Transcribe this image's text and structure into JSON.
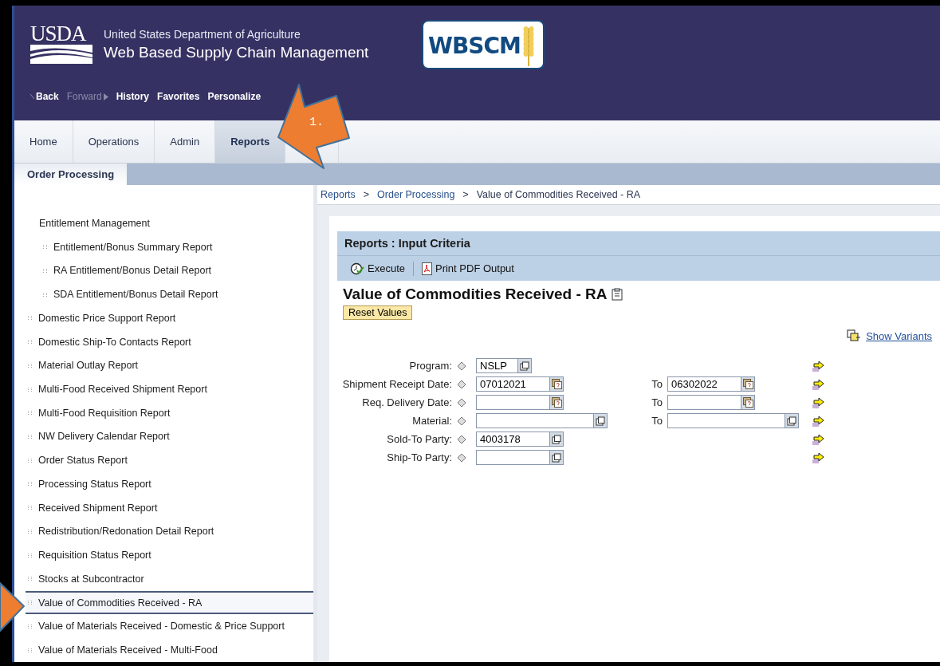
{
  "header": {
    "usda_mark": "USDA",
    "agency": "United States Department of Agriculture",
    "app_name": "Web Based Supply Chain Management",
    "logo": "WBSCM"
  },
  "nav": [
    {
      "label": "Back",
      "disabled": false,
      "kind": "back"
    },
    {
      "label": "Forward",
      "disabled": true,
      "kind": "forward"
    },
    {
      "label": "History",
      "disabled": false,
      "kind": "plain"
    },
    {
      "label": "Favorites",
      "disabled": false,
      "kind": "plain"
    },
    {
      "label": "Personalize",
      "disabled": false,
      "kind": "plain"
    }
  ],
  "tabs": [
    {
      "label": "Home",
      "selected": false
    },
    {
      "label": "Operations",
      "selected": false
    },
    {
      "label": "Admin",
      "selected": false
    },
    {
      "label": "Reports",
      "selected": true
    }
  ],
  "subtabs": [
    {
      "label": "Order Processing",
      "selected": true
    }
  ],
  "breadcrumb": [
    {
      "label": "Reports",
      "kind": "link"
    },
    {
      "label": ">",
      "kind": "separator"
    },
    {
      "label": "Order Processing",
      "kind": "link"
    },
    {
      "label": ">",
      "kind": "separator"
    },
    {
      "label": "Value of Commodities Received - RA",
      "kind": "current"
    }
  ],
  "sidebar": [
    {
      "label": "Entitlement Management",
      "selected": false,
      "children": [
        {
          "label": "Entitlement/Bonus Summary Report",
          "selected": false
        },
        {
          "label": "RA Entitlement/Bonus Detail Report",
          "selected": false
        },
        {
          "label": "SDA Entitlement/Bonus Detail Report",
          "selected": false
        }
      ]
    },
    {
      "label": "Domestic Price Support Report",
      "selected": false
    },
    {
      "label": "Domestic Ship-To Contacts Report",
      "selected": false
    },
    {
      "label": "Material Outlay Report",
      "selected": false
    },
    {
      "label": "Multi-Food Received Shipment Report",
      "selected": false
    },
    {
      "label": "Multi-Food Requisition Report",
      "selected": false
    },
    {
      "label": "NW Delivery Calendar Report",
      "selected": false
    },
    {
      "label": "Order Status Report",
      "selected": false
    },
    {
      "label": "Processing Status Report",
      "selected": false
    },
    {
      "label": "Received Shipment Report",
      "selected": false
    },
    {
      "label": "Redistribution/Redonation Detail Report",
      "selected": false
    },
    {
      "label": "Requisition Status Report",
      "selected": false
    },
    {
      "label": "Stocks at Subcontractor",
      "selected": false
    },
    {
      "label": "Value of Commodities Received - RA",
      "selected": true
    },
    {
      "label": "Value of Materials Received - Domestic & Price Support",
      "selected": false
    },
    {
      "label": "Value of Materials Received - Multi-Food",
      "selected": false
    }
  ],
  "panel": {
    "title": "Reports : Input Criteria",
    "toolbar": [
      {
        "label": "Execute",
        "kind": "execute"
      },
      {
        "label": "Print PDF Output",
        "kind": "pdf"
      }
    ],
    "report_title": "Value of Commodities Received - RA",
    "reset_button": "Reset Values",
    "variants_link": "Show Variants",
    "fields": [
      {
        "label": "Program:",
        "kind": "code",
        "value": "NSLP"
      },
      {
        "label": "Shipment Receipt Date:",
        "kind": "date",
        "value": "07012021",
        "to": {
          "label": "To",
          "value": "06302022"
        }
      },
      {
        "label": "Req. Delivery Date:",
        "kind": "date",
        "to": {
          "label": "To"
        }
      },
      {
        "label": "Material:",
        "kind": "range-lookup",
        "to": {
          "label": "To"
        }
      },
      {
        "label": "Sold-To Party:",
        "kind": "lookup",
        "value": "4003178"
      },
      {
        "label": "Ship-To Party:",
        "kind": "lookup"
      }
    ]
  },
  "callouts": [
    {
      "kind": "numbered",
      "label": "1."
    },
    {
      "kind": "plain"
    }
  ]
}
